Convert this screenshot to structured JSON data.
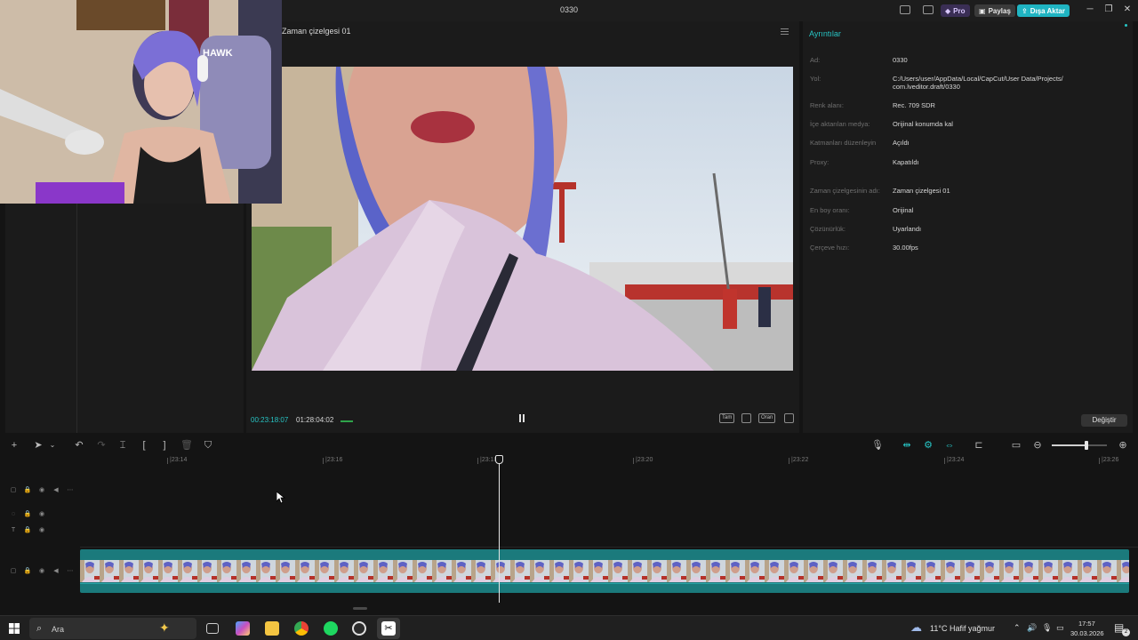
{
  "window": {
    "title": "0330",
    "pro_label": "Pro",
    "share_label": "Paylaş",
    "export_label": "Dışa Aktar"
  },
  "player": {
    "title": "Zaman çizelgesi 01",
    "current_time": "00:23:18:07",
    "total_time": "01:28:04:02",
    "full_label": "Tam",
    "ratio_label": "Oran"
  },
  "details": {
    "title": "Ayrıntılar",
    "rows": [
      {
        "label": "Ad:",
        "value": "0330"
      },
      {
        "label": "Yol:",
        "value": "C:/Users/user/AppData/Local/CapCut/User Data/Projects/ com.lveditor.draft/0330"
      },
      {
        "label": "Renk alanı:",
        "value": "Rec. 709 SDR"
      },
      {
        "label": "İçe aktarılan medya:",
        "value": "Orijinal konumda kal"
      },
      {
        "label": "Katmanları düzenleyin",
        "value": "Açıldı"
      },
      {
        "label": "Proxy:",
        "value": "Kapatıldı"
      },
      {
        "label": "Zaman çizelgesinin adı:",
        "value": "Zaman çizelgesi 01"
      },
      {
        "label": "En boy oranı:",
        "value": "Orijinal"
      },
      {
        "label": "Çözünürlük:",
        "value": "Uyarlandı"
      },
      {
        "label": "Çerçeve hızı:",
        "value": "30.00fps"
      }
    ],
    "change_label": "Değiştir"
  },
  "ruler": {
    "ticks": [
      "|23:14",
      "|23:16",
      "|23:18",
      "|23:20",
      "|23:22",
      "|23:24",
      "|23:26"
    ]
  },
  "taskbar": {
    "search_placeholder": "Ara",
    "weather": "11°C  Hafif yağmur",
    "time": "17:57",
    "date": "30.03.2026",
    "notification_count": "2"
  },
  "colors": {
    "accent": "#27c4c4",
    "clip": "#1b7a7c",
    "export_btn": "#1fb4c2"
  }
}
